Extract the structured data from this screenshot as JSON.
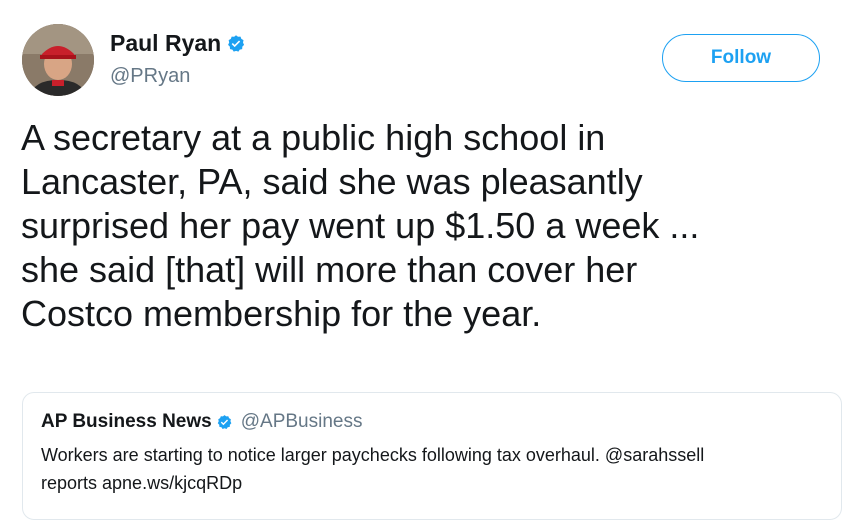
{
  "author": {
    "display_name": "Paul Ryan",
    "handle": "@PRyan",
    "verified_icon": "verified-badge-icon"
  },
  "follow_button": {
    "label": "Follow"
  },
  "tweet": {
    "text_lines": [
      "A secretary at a public high school in",
      "Lancaster, PA, said she was pleasantly",
      "surprised her pay went up $1.50 a week ...",
      "she said [that] will more than cover her",
      "Costco membership for the year."
    ]
  },
  "quoted_tweet": {
    "display_name": "AP Business News",
    "handle": "@APBusiness",
    "text_lines": [
      "Workers are starting to notice larger paychecks following tax overhaul. @sarahssell",
      "reports apne.ws/kjcqRDp"
    ]
  },
  "colors": {
    "accent": "#1da1f2",
    "text": "#14171a",
    "secondary": "#657786",
    "border": "#e1e8ed"
  }
}
